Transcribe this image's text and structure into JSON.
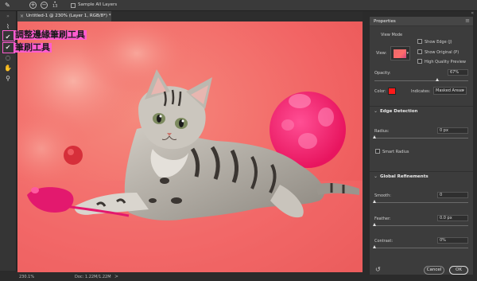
{
  "options_bar": {
    "brush_size": "13",
    "sample_all_layers": "Sample All Layers",
    "add_symbol": "+",
    "subtract_symbol": "−"
  },
  "document_tab": {
    "close": "×",
    "title": "Untitled-1 @ 230% (Layer 1, RGB/8*) *"
  },
  "annotations": {
    "refine_edge_brush": "調整邊緣筆刷工具",
    "brush_tool": "筆刷工具"
  },
  "status_bar": {
    "zoom": "230.1%",
    "doc": "Doc: 1.22M/1.22M",
    "arrow": ">"
  },
  "properties": {
    "title": "Properties",
    "menu": "≡",
    "view_mode": {
      "label": "View Mode",
      "view_label": "View:",
      "show_edge": "Show Edge (J)",
      "show_original": "Show Original (P)",
      "high_quality_preview": "High Quality Preview"
    },
    "opacity": {
      "label": "Opacity:",
      "value": "67%",
      "fraction": 0.67
    },
    "color_label": "Color:",
    "color": "#ff1a1a",
    "indicates": {
      "label": "Indicates:",
      "value": "Masked Areas"
    },
    "edge_detection": {
      "title": "Edge Detection",
      "radius_label": "Radius:",
      "radius_value": "0 px",
      "radius_fraction": 0.0,
      "smart_radius": "Smart Radius"
    },
    "global_refinements": {
      "title": "Global Refinements",
      "smooth_label": "Smooth:",
      "smooth_value": "0",
      "feather_label": "Feather:",
      "feather_value": "0.0 px",
      "contrast_label": "Contrast:",
      "contrast_value": "0%"
    },
    "cancel": "Cancel",
    "ok": "OK",
    "reset_icon": "↺"
  },
  "colors": {
    "background_coral": "#f25f5f",
    "annotation_magenta": "#ff5cd0",
    "ball_pink": "#ff2d7a"
  }
}
